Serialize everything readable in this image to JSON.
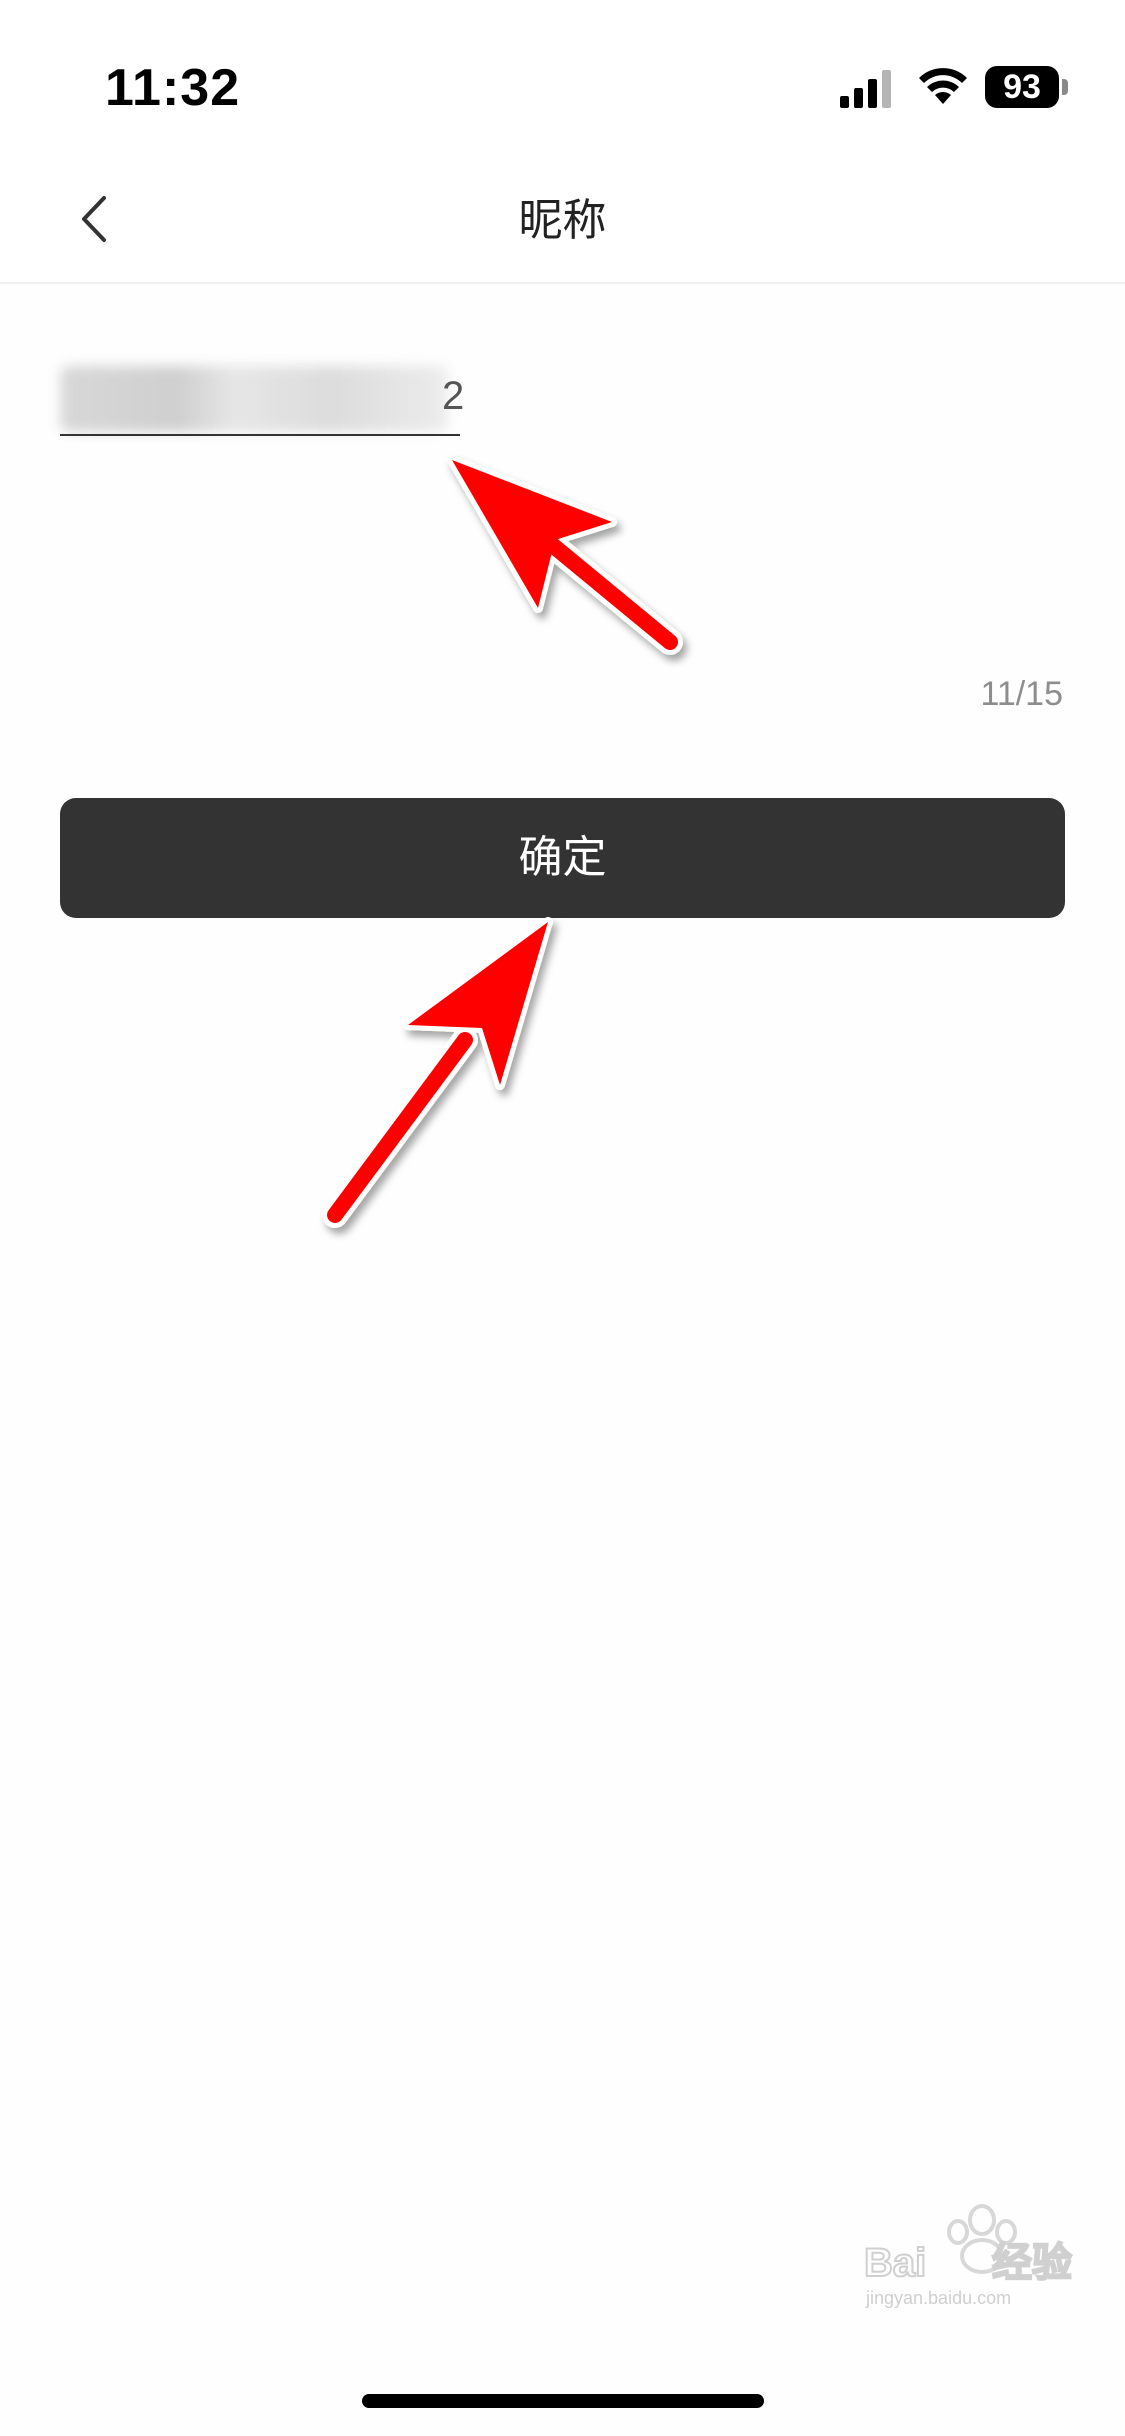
{
  "status_bar": {
    "time": "11:32",
    "battery": "93",
    "icons": [
      "signal-icon",
      "wifi-icon",
      "battery-icon"
    ]
  },
  "nav": {
    "back_icon": "chevron-left-icon",
    "title": "昵称"
  },
  "nickname_field": {
    "visible_tail": "2",
    "blurred": true
  },
  "char_count": "11/15",
  "confirm_button": {
    "label": "确定"
  },
  "annotations": {
    "arrow_color": "#ff0000"
  },
  "watermark": {
    "brand": "Baidu 经验",
    "url": "jingyan.baidu.com"
  },
  "colors": {
    "button_bg": "#333333",
    "button_text": "#ffffff",
    "count_text": "#8d8d8d"
  }
}
